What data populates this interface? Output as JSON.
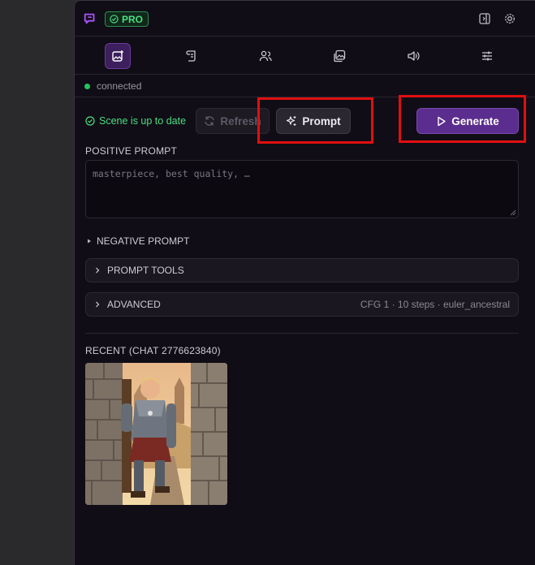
{
  "header": {
    "badge": "PRO"
  },
  "status": {
    "text": "connected"
  },
  "actions": {
    "scene_status": "Scene is up to date",
    "refresh": "Refresh",
    "prompt": "Prompt",
    "generate": "Generate"
  },
  "positive": {
    "label": "POSITIVE PROMPT",
    "placeholder": "masterpiece, best quality, …"
  },
  "negative": {
    "label": "NEGATIVE PROMPT"
  },
  "sections": {
    "tools": "PROMPT TOOLS",
    "advanced": "ADVANCED",
    "advanced_meta": "CFG 1 · 10 steps · euler_ancestral"
  },
  "recent": {
    "label": "RECENT (CHAT 2776623840)"
  },
  "colors": {
    "accent": "#5b2d8e",
    "success": "#4ade80",
    "highlight": "#e10f0f"
  },
  "icons": [
    "chat-logo-icon",
    "check-circle-icon",
    "panel-icon",
    "gear-icon",
    "image-icon",
    "scroll-icon",
    "users-icon",
    "gallery-icon",
    "speaker-icon",
    "sliders-icon",
    "refresh-icon",
    "sparkles-icon",
    "play-icon",
    "chevron-right-icon",
    "triangle-right-icon"
  ]
}
